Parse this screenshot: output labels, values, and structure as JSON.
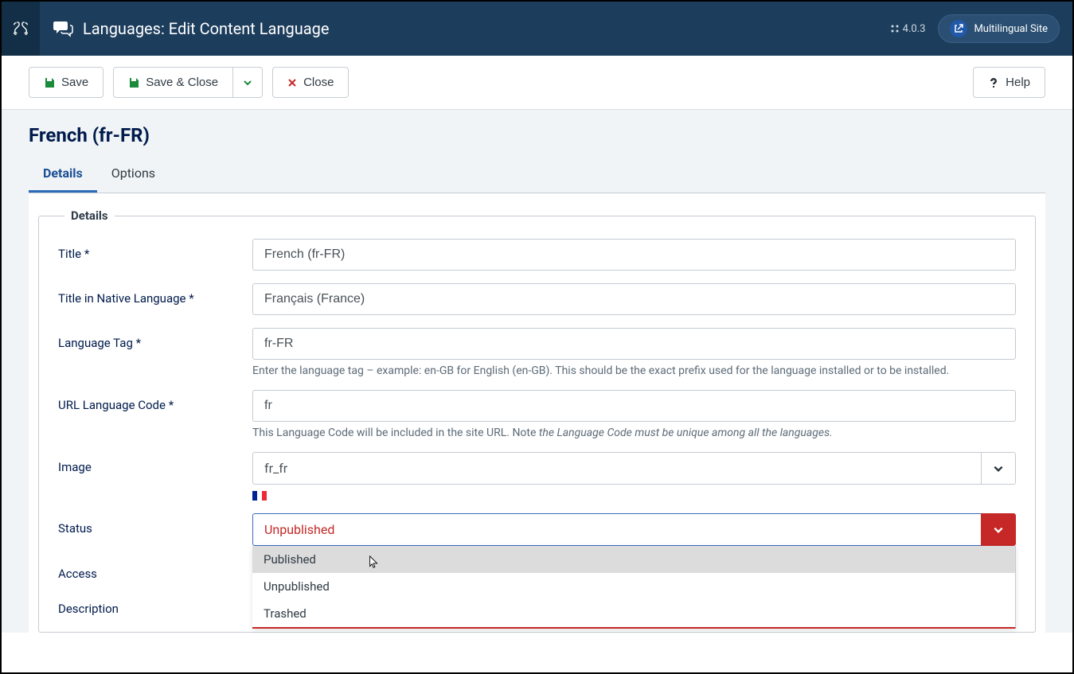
{
  "header": {
    "title": "Languages: Edit Content Language",
    "version": "4.0.3",
    "site_link_label": "Multilingual Site"
  },
  "toolbar": {
    "save": "Save",
    "save_close": "Save & Close",
    "close": "Close",
    "help": "Help"
  },
  "page": {
    "title": "French (fr-FR)"
  },
  "tabs": [
    {
      "label": "Details",
      "active": true
    },
    {
      "label": "Options",
      "active": false
    }
  ],
  "fieldset": {
    "legend": "Details"
  },
  "fields": {
    "title": {
      "label": "Title *",
      "value": "French (fr-FR)"
    },
    "native": {
      "label": "Title in Native Language *",
      "value": "Français (France)"
    },
    "tag": {
      "label": "Language Tag *",
      "value": "fr-FR",
      "help": "Enter the language tag – example: en-GB for English (en-GB). This should be the exact prefix used for the language installed or to be installed."
    },
    "urlcode": {
      "label": "URL Language Code *",
      "value": "fr",
      "help_pre": "This Language Code will be included in the site URL. Note ",
      "help_em": "the Language Code must be unique among all the languages.",
      "help_post": ""
    },
    "image": {
      "label": "Image",
      "value": "fr_fr"
    },
    "status": {
      "label": "Status",
      "value": "Unpublished",
      "options": [
        "Published",
        "Unpublished",
        "Trashed"
      ]
    },
    "access": {
      "label": "Access"
    },
    "description": {
      "label": "Description"
    }
  }
}
